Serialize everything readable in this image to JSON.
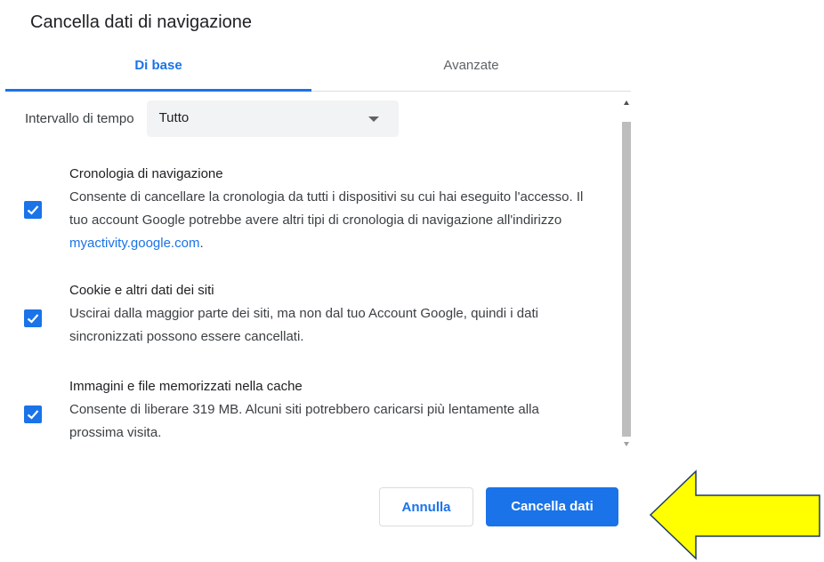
{
  "dialog": {
    "title": "Cancella dati di navigazione"
  },
  "tabs": [
    {
      "label": "Di base",
      "active": true
    },
    {
      "label": "Avanzate",
      "active": false
    }
  ],
  "time_range": {
    "label": "Intervallo di tempo",
    "value": "Tutto"
  },
  "options": [
    {
      "title": "Cronologia di navigazione",
      "description": "Consente di cancellare la cronologia da tutti i dispositivi su cui hai eseguito l'accesso. Il tuo account Google potrebbe avere altri tipi di cronologia di navigazione all'indirizzo ",
      "link": "myactivity.google.com",
      "description_end": ".",
      "checked": true
    },
    {
      "title": "Cookie e altri dati dei siti",
      "description": "Uscirai dalla maggior parte dei siti, ma non dal tuo Account Google, quindi i dati sincronizzati possono essere cancellati.",
      "checked": true
    },
    {
      "title": "Immagini e file memorizzati nella cache",
      "description": "Consente di liberare 319 MB. Alcuni siti potrebbero caricarsi più lentamente alla prossima visita.",
      "checked": true
    }
  ],
  "buttons": {
    "cancel": "Annulla",
    "clear": "Cancella dati"
  },
  "colors": {
    "accent": "#1a73e8",
    "arrow_fill": "#ffff00",
    "arrow_stroke": "#1f3a68"
  },
  "icons": {
    "checkbox": "check-icon",
    "dropdown": "caret-down-icon",
    "annotation": "left-arrow-icon"
  }
}
